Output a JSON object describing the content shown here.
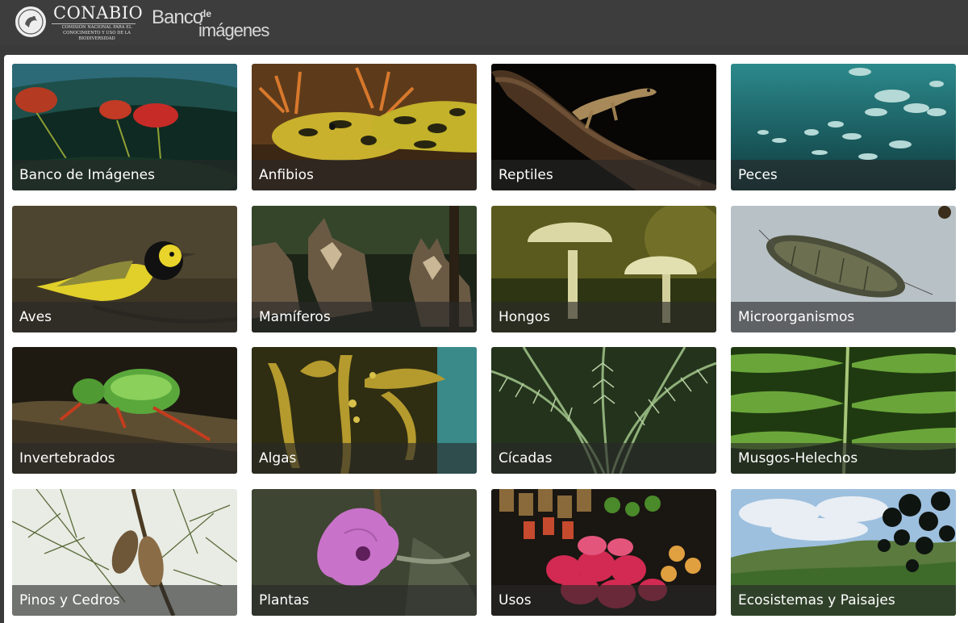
{
  "header": {
    "org_name": "CONABIO",
    "org_subtitle": "Comisión Nacional para el Conocimiento y Uso de la Biodiversidad",
    "brand_word1": "Banco",
    "brand_word2": "de",
    "brand_word3": "imágenes"
  },
  "categories": [
    {
      "label": "Banco de Imágenes",
      "icon": "underwater-flowers"
    },
    {
      "label": "Anfibios",
      "icon": "axolotl"
    },
    {
      "label": "Reptiles",
      "icon": "lizard"
    },
    {
      "label": "Peces",
      "icon": "fish-school"
    },
    {
      "label": "Aves",
      "icon": "warbler-bird"
    },
    {
      "label": "Mamíferos",
      "icon": "wolves"
    },
    {
      "label": "Hongos",
      "icon": "mushrooms"
    },
    {
      "label": "Microorganismos",
      "icon": "micro-larva"
    },
    {
      "label": "Invertebrados",
      "icon": "green-beetle"
    },
    {
      "label": "Algas",
      "icon": "kelp"
    },
    {
      "label": "Cícadas",
      "icon": "cycad-fronds"
    },
    {
      "label": "Musgos-Helechos",
      "icon": "fern"
    },
    {
      "label": "Pinos y Cedros",
      "icon": "pine-cones"
    },
    {
      "label": "Plantas",
      "icon": "pink-flower"
    },
    {
      "label": "Usos",
      "icon": "dragon-fruit-market"
    },
    {
      "label": "Ecosistemas y Paisajes",
      "icon": "landscape"
    }
  ]
}
